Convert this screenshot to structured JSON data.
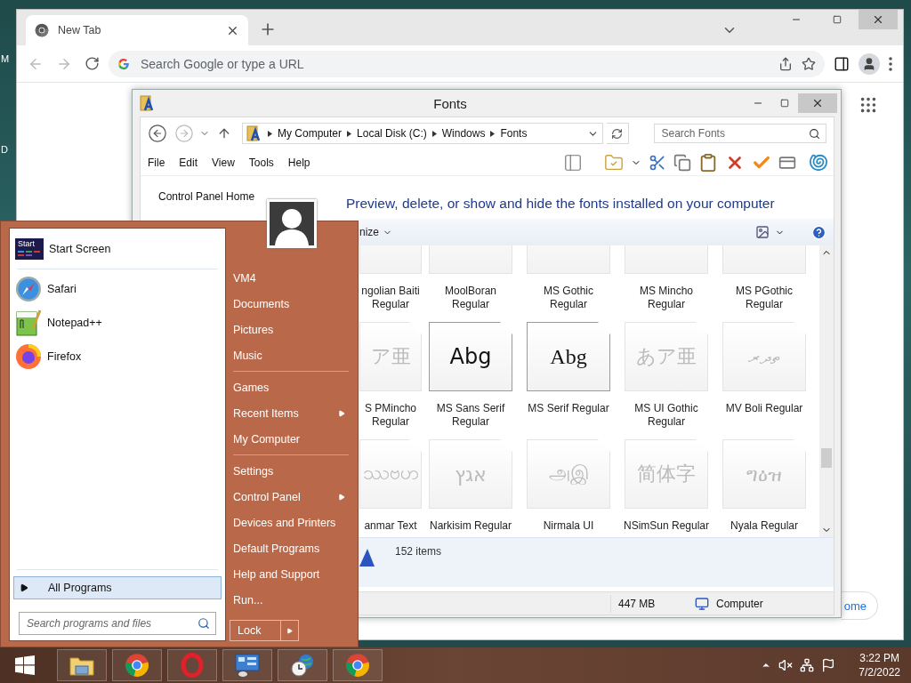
{
  "desktop": {
    "icon_labels": [
      "M",
      "D"
    ]
  },
  "browser": {
    "tabs": [
      {
        "title": "New Tab",
        "selected": true
      }
    ],
    "back": {
      "disabled": true
    },
    "forward": {
      "disabled": true
    },
    "omnibox": {
      "placeholder": "Search Google or type a URL"
    },
    "page": {
      "customize_button": "ome"
    }
  },
  "explorer": {
    "title": "Fonts",
    "back": {
      "disabled": false
    },
    "forward": {
      "disabled": true
    },
    "breadcrumb": [
      "My Computer",
      "Local Disk (C:)",
      "Windows",
      "Fonts"
    ],
    "search": {
      "placeholder": "Search Fonts"
    },
    "menu": [
      "File",
      "Edit",
      "View",
      "Tools",
      "Help"
    ],
    "nav_pane": [
      "Control Panel Home"
    ],
    "header": "Preview, delete, or show and hide the fonts installed on your computer",
    "command_bar": {
      "organize": "nize"
    },
    "fonts": [
      {
        "name": "ngolian Baiti Regular",
        "kind": "truetype"
      },
      {
        "name": "MoolBoran Regular",
        "kind": "truetype"
      },
      {
        "name": "MS Gothic Regular",
        "kind": "truetype"
      },
      {
        "name": "MS Mincho Regular",
        "kind": "truetype"
      },
      {
        "name": "MS PGothic Regular",
        "kind": "truetype"
      },
      {
        "name": "S PMincho Regular",
        "kind": "truetype",
        "sample": "ア亜"
      },
      {
        "name": "MS Sans Serif Regular",
        "kind": "bitmap",
        "serif": false,
        "sample": "Abg"
      },
      {
        "name": "MS Serif Regular",
        "kind": "bitmap",
        "serif": true,
        "sample": "Abg"
      },
      {
        "name": "MS UI Gothic Regular",
        "kind": "truetype",
        "sample": "あア亜"
      },
      {
        "name": "MV Boli Regular",
        "kind": "truetype",
        "sample": "ތދރ"
      },
      {
        "name": "anmar Text",
        "kind": "family",
        "sample": "ဿဗဟ"
      },
      {
        "name": "Narkisim Regular",
        "kind": "truetype",
        "sample": "אגץ"
      },
      {
        "name": "Nirmala UI",
        "kind": "family",
        "sample": "அஇ"
      },
      {
        "name": "NSimSun Regular",
        "kind": "truetype",
        "sample": "简体字"
      },
      {
        "name": "Nyala Regular",
        "kind": "truetype",
        "sample": "ግዕዝ"
      }
    ],
    "details": {
      "count": "152 items"
    },
    "status_bar": {
      "size": "447 MB",
      "location": "Computer"
    }
  },
  "start_menu": {
    "pinned": [
      {
        "label": "Start Screen",
        "tile_label": "Start",
        "kind": "tile"
      }
    ],
    "programs": [
      {
        "label": "Safari",
        "kind": "safari"
      },
      {
        "label": "Notepad++",
        "kind": "notepad"
      },
      {
        "label": "Firefox",
        "kind": "firefox"
      }
    ],
    "all_programs": {
      "label": "All Programs",
      "selected": true
    },
    "search": {
      "placeholder": "Search programs and files"
    },
    "places": [
      [
        {
          "label": "VM4",
          "submenu": false
        },
        {
          "label": "Documents",
          "submenu": false
        },
        {
          "label": "Pictures",
          "submenu": false
        },
        {
          "label": "Music",
          "submenu": false
        }
      ],
      [
        {
          "label": "Games",
          "submenu": false
        },
        {
          "label": "Recent Items",
          "submenu": true
        },
        {
          "label": "My Computer",
          "submenu": false
        }
      ],
      [
        {
          "label": "Settings",
          "submenu": false
        },
        {
          "label": "Control Panel",
          "submenu": true
        },
        {
          "label": "Devices and Printers",
          "submenu": false
        },
        {
          "label": "Default Programs",
          "submenu": false
        },
        {
          "label": "Help and Support",
          "submenu": false
        },
        {
          "label": "Run...",
          "submenu": false
        }
      ]
    ],
    "power": {
      "label": "Lock"
    }
  },
  "taskbar": {
    "apps": [
      {
        "kind": "explorer"
      },
      {
        "kind": "chrome"
      },
      {
        "kind": "opera"
      },
      {
        "kind": "control"
      },
      {
        "kind": "clock"
      },
      {
        "kind": "chrome"
      }
    ],
    "clock": {
      "time": "3:22 PM",
      "date": "7/2/2022"
    }
  }
}
